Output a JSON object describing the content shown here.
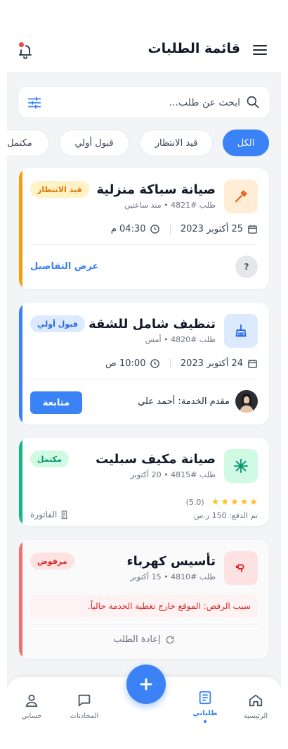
{
  "header": {
    "title": "قائمة الطلبات"
  },
  "search": {
    "placeholder": "ابحث عن طلب..."
  },
  "filters": [
    "الكل",
    "قيد الانتظار",
    "قبول أولي",
    "مكتمل"
  ],
  "orders": [
    {
      "title": "صيانة سباكة منزلية",
      "subtitle": "طلب #4821 • منذ ساعتين",
      "status": "قيد الانتظار",
      "date": "25 أكتوبر 2023",
      "time": "04:30 م",
      "help": "?",
      "action": "عرض التفاصيل",
      "color": "#f59e0b"
    },
    {
      "title": "تنظيف شامل للشقة",
      "subtitle": "طلب #4820 • أمس",
      "status": "قبول أولي",
      "date": "24 أكتوبر 2023",
      "time": "10:00 ص",
      "provider": "مقدم الخدمة: أحمد علي",
      "action": "متابعة",
      "color": "#3b82f6"
    },
    {
      "title": "صيانة مكيف سبليت",
      "subtitle": "طلب #4815 • 20 أكتوبر",
      "status": "مكتمل",
      "rating": "(5.0)",
      "rating_value": 5,
      "paid": "تم الدفع: 150 ر.س",
      "invoice": "الفاتورة",
      "color": "#10b981"
    },
    {
      "title": "تأسيس كهرباء",
      "subtitle": "طلب #4810 • 15 أكتوبر",
      "status": "مرفوض",
      "reason": "سبب الرفض: الموقع خارج تغطية الخدمة حالياً.",
      "reorder": "إعادة الطلب",
      "color": "#ef4444"
    }
  ],
  "nav": {
    "home": "الرئيسية",
    "orders": "طلباتي",
    "chats": "المحادثات",
    "account": "حسابي"
  }
}
